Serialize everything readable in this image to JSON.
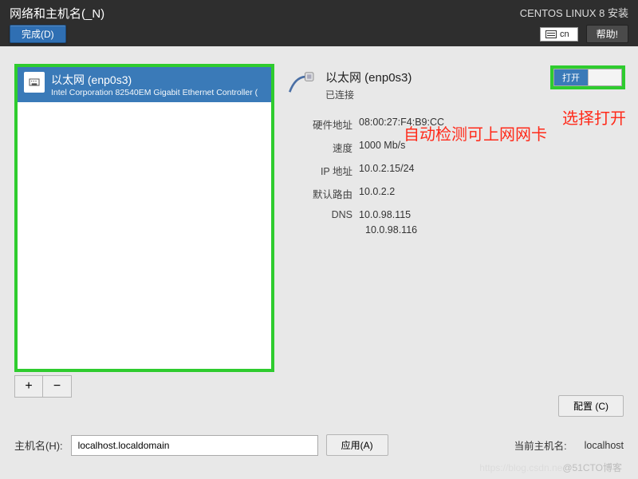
{
  "header": {
    "page_title": "网络和主机名(_N)",
    "done_label": "完成(D)",
    "install_title": "CENTOS LINUX 8 安装",
    "keyboard_indicator": "cn",
    "help_label": "帮助!"
  },
  "nic_list": {
    "items": [
      {
        "title": "以太网 (enp0s3)",
        "subtitle": "Intel Corporation 82540EM Gigabit Ethernet Controller ("
      }
    ],
    "add_label": "+",
    "remove_label": "−"
  },
  "details": {
    "name": "以太网 (enp0s3)",
    "status": "已连接",
    "toggle_on_label": "打开",
    "props": {
      "hw_addr_label": "硬件地址",
      "hw_addr": "08:00:27:F4:B9:CC",
      "speed_label": "速度",
      "speed": "1000 Mb/s",
      "ip_label": "IP 地址",
      "ip": "10.0.2.15/24",
      "route_label": "默认路由",
      "route": "10.0.2.2",
      "dns_label": "DNS",
      "dns1": "10.0.98.115",
      "dns2": "10.0.98.116"
    },
    "configure_label": "配置 (C)"
  },
  "hostname": {
    "label": "主机名(H):",
    "value": "localhost.localdomain",
    "apply_label": "应用(A)",
    "current_label": "当前主机名:",
    "current_value": "localhost"
  },
  "annotations": {
    "left": "自动检测可上网网卡",
    "right": "选择打开"
  },
  "watermark": {
    "light": "https://blog.csdn.ne",
    "dark": "@51CTO博客"
  }
}
